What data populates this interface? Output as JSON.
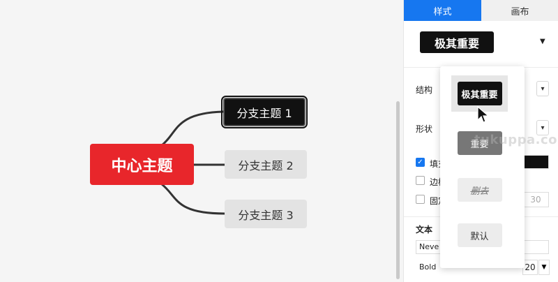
{
  "canvas": {
    "central_topic": "中心主题",
    "branches": [
      "分支主题 1",
      "分支主题 2",
      "分支主题 3"
    ],
    "colors": {
      "central": "#e8262b",
      "branch_selected": "#111111",
      "branch": "#e3e3e3",
      "connector": "#333333"
    }
  },
  "panel": {
    "tabs": [
      {
        "label": "样式",
        "active": true
      },
      {
        "label": "画布",
        "active": false
      }
    ],
    "style_preview": "极其重要",
    "structure_label": "结构",
    "shape_label": "形状",
    "fill_label": "填充",
    "border_label": "边框",
    "fixed_label": "固定宽度",
    "fixed_width_value": "30",
    "text_section_label": "文本",
    "font_family": "Neve",
    "font_weight": "Bold",
    "font_size": "20",
    "accent_color": "#1677f0"
  },
  "dropdown": {
    "options": [
      {
        "label": "极其重要",
        "selected": true
      },
      {
        "label": "重要",
        "selected": false
      },
      {
        "label": "删去",
        "selected": false
      },
      {
        "label": "默认",
        "selected": false
      }
    ]
  },
  "watermark": "tukuppa.com"
}
